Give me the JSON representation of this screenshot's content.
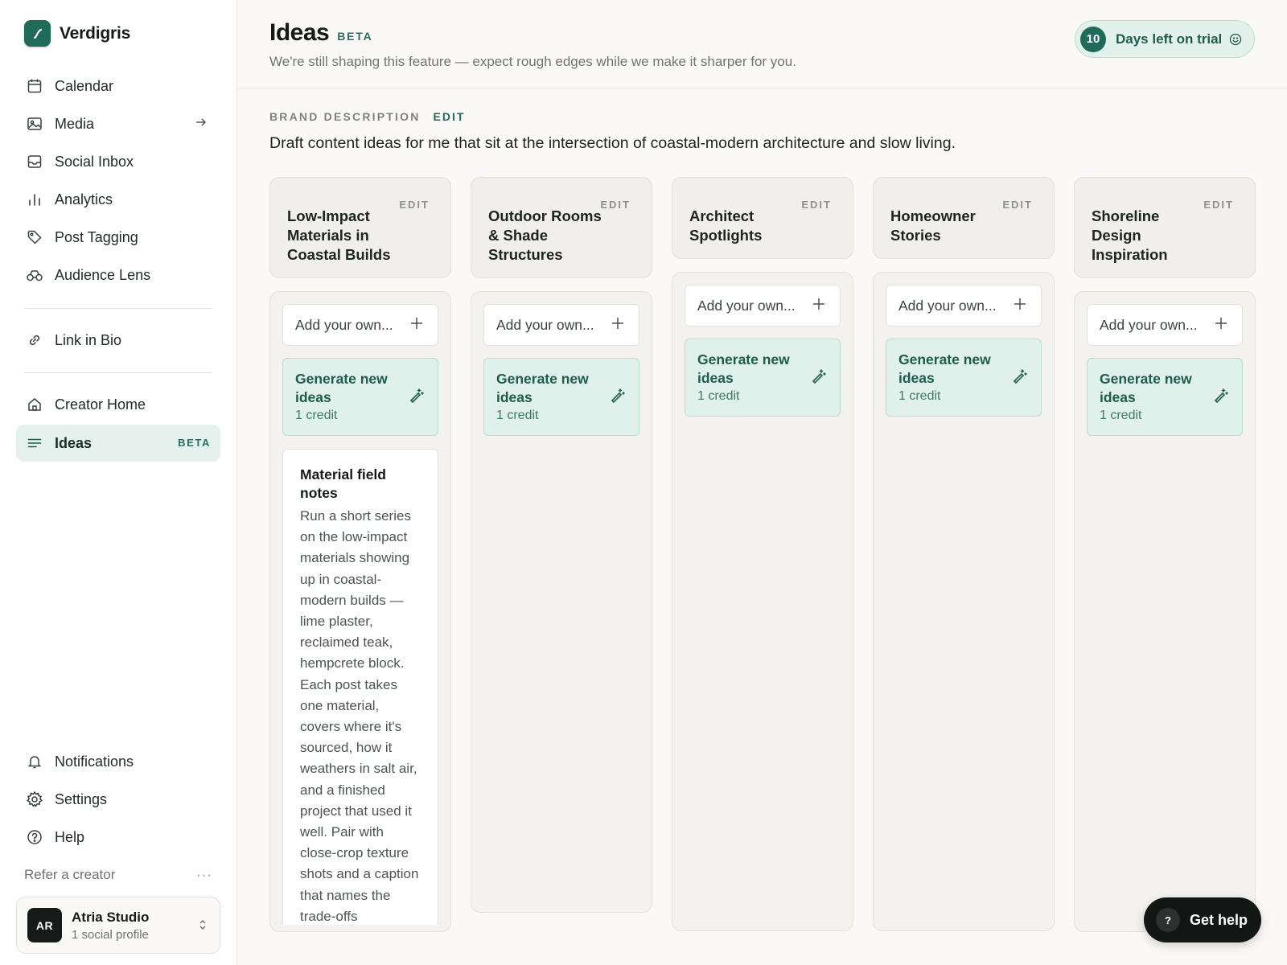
{
  "app": {
    "name": "Verdigris"
  },
  "sidebar": {
    "items": [
      {
        "label": "Calendar",
        "icon": "calendar-icon"
      },
      {
        "label": "Media",
        "icon": "image-icon"
      },
      {
        "label": "Social Inbox",
        "icon": "inbox-icon"
      },
      {
        "label": "Analytics",
        "icon": "bar-chart-icon"
      },
      {
        "label": "Post Tagging",
        "icon": "tag-icon"
      },
      {
        "label": "Audience Lens",
        "icon": "binoculars-icon"
      },
      {
        "label": "Link in Bio",
        "icon": "link-icon"
      },
      {
        "label": "Creator Home",
        "icon": "home-icon"
      },
      {
        "label": "Ideas",
        "icon": "ideas-icon",
        "badge": "BETA",
        "active": true
      }
    ],
    "bottom_items": [
      {
        "label": "Notifications",
        "icon": "bell-icon"
      },
      {
        "label": "Settings",
        "icon": "gear-icon"
      },
      {
        "label": "Help",
        "icon": "help-icon"
      }
    ],
    "refer": "Refer a creator",
    "account": {
      "initials": "AR",
      "name": "Atria Studio",
      "sub": "1 social profile"
    }
  },
  "header": {
    "title": "Ideas",
    "beta": "BETA",
    "subtitle": "We're still shaping this feature — expect rough edges while we make it sharper for you.",
    "trial": {
      "days": "10",
      "text": "Days left on trial"
    }
  },
  "brand_description": {
    "label": "BRAND DESCRIPTION",
    "edit": "EDIT",
    "text": "Draft content ideas for me that sit at the intersection of coastal-modern architecture and slow living."
  },
  "column_common": {
    "edit": "EDIT",
    "add_placeholder": "Add your own...",
    "generate_label": "Generate new ideas",
    "generate_credit": "1 credit"
  },
  "columns": [
    {
      "title": "Low-Impact Materials in Coastal Builds",
      "ideas": [
        {
          "title": "Material field notes",
          "text": "Run a short series on the low-impact materials showing up in coastal-modern builds — lime plaster, reclaimed teak, hempcrete block. Each post takes one material, covers where it's sourced, how it weathers in salt air, and a finished project that used it well. Pair with close-crop texture shots and a caption that names the trade-offs"
        }
      ]
    },
    {
      "title": "Outdoor Rooms & Shade Structures",
      "ideas": []
    },
    {
      "title": "Architect Spotlights",
      "ideas": []
    },
    {
      "title": "Homeowner Stories",
      "ideas": []
    },
    {
      "title": "Shoreline Design Inspiration",
      "ideas": []
    }
  ],
  "help": {
    "label": "Get help",
    "glyph": "?"
  },
  "colors": {
    "accent": "#1f6a58",
    "accent_light": "#e0f0ea",
    "ink": "#1d2320"
  }
}
